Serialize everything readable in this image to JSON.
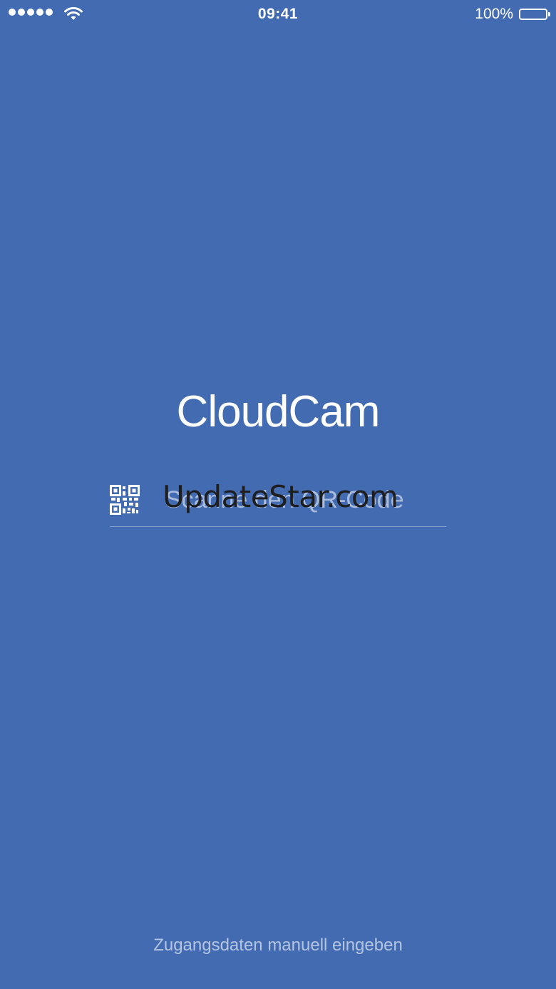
{
  "status_bar": {
    "time": "09:41",
    "battery_percent": "100%",
    "signal_bars": 5,
    "icons": [
      "signal-dots-icon",
      "wifi-icon",
      "battery-icon"
    ]
  },
  "logo": {
    "part_light": "Cloud",
    "part_bold": "Cam"
  },
  "scan": {
    "label": "Scanne den QR-Code",
    "icon": "qr-code-icon"
  },
  "watermark": {
    "text": "UpdateStar.com"
  },
  "manual_entry": {
    "label": "Zugangsdaten manuell eingeben"
  },
  "colors": {
    "background": "#436bb2",
    "text": "#ffffff"
  }
}
